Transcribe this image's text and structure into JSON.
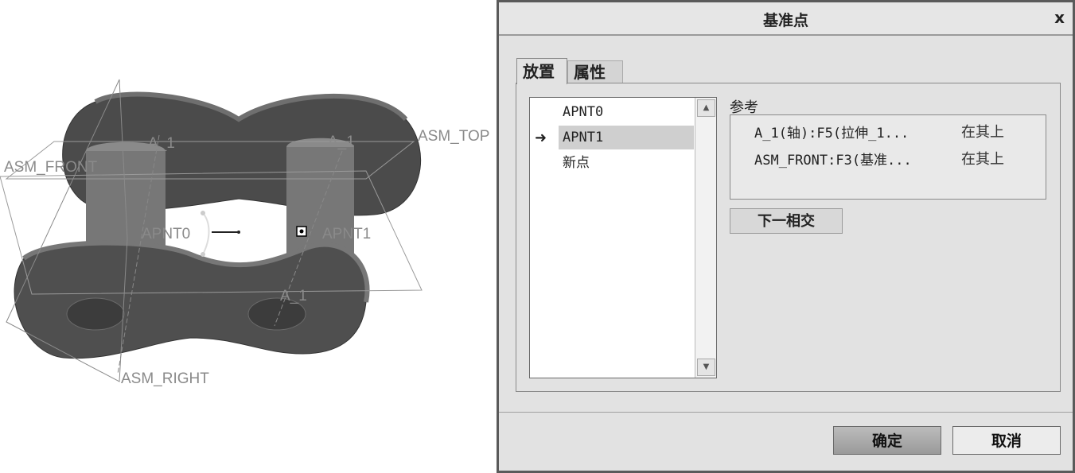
{
  "viewport": {
    "labels": {
      "asm_top": "ASM_TOP",
      "asm_front": "ASM_FRONT",
      "asm_right": "ASM_RIGHT",
      "axis_a1_left": "A_1",
      "axis_a1_right": "A_1",
      "axis_a1_lower": "A_1",
      "apnt0": "APNT0",
      "apnt1": "APNT1"
    }
  },
  "dialog": {
    "title": "基准点",
    "close_glyph": "x",
    "tabs": {
      "placement": "放置",
      "properties": "属性"
    },
    "points": [
      "APNT0",
      "APNT1",
      "新点"
    ],
    "selected_arrow": "➜",
    "references": {
      "label": "参考",
      "rows": [
        {
          "ref": "A_1(轴):F5(拉伸_1...",
          "constraint": "在其上"
        },
        {
          "ref": "ASM_FRONT:F3(基准...",
          "constraint": "在其上"
        }
      ]
    },
    "next_intersection": "下一相交",
    "ok": "确定",
    "cancel": "取消"
  }
}
